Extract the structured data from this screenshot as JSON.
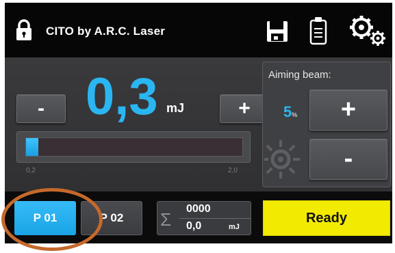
{
  "header": {
    "title": "CITO by A.R.C. Laser",
    "icons": [
      "lock-icon",
      "floppy-disk-icon",
      "clipboard-icon",
      "gears-icon"
    ]
  },
  "energy": {
    "minus_label": "-",
    "plus_label": "+",
    "value": "0,3",
    "unit": "mJ",
    "range_min": "0,2",
    "range_max": "2,0",
    "level_fraction": 0.056
  },
  "aiming_beam": {
    "title": "Aiming beam:",
    "value": "5",
    "unit": "%",
    "plus_label": "+",
    "minus_label": "-"
  },
  "footer": {
    "program_1": "P 01",
    "program_2": "P 02",
    "counter_symbol": "Σ",
    "pulse_count": "0000",
    "total_energy": "0,0",
    "total_unit": "mJ",
    "status": "Ready"
  },
  "colors": {
    "accent_blue": "#2ab6f2",
    "ready_yellow": "#f2ea00",
    "highlight_orange": "#c5692b",
    "background": "#111111"
  }
}
